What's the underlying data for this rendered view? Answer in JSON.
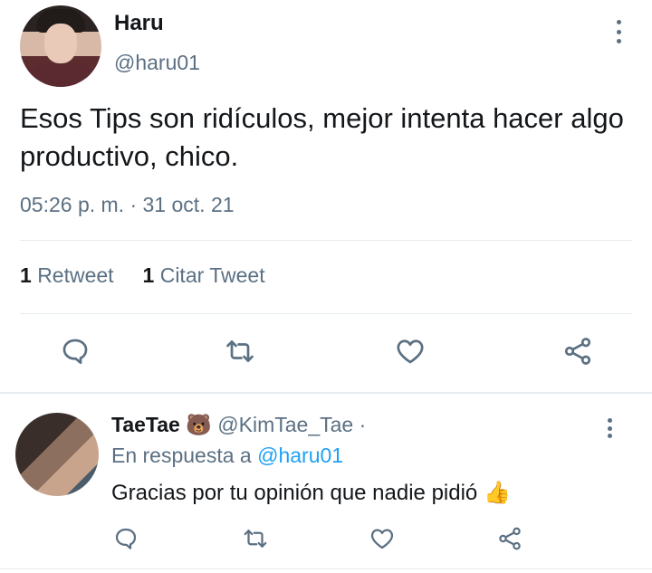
{
  "tweet": {
    "author_name": "Haru",
    "author_handle": "@haru01",
    "text": "Esos Tips son ridículos, mejor intenta hacer algo productivo, chico.",
    "timestamp": "05:26 p. m. · 31 oct. 21",
    "retweet_count": "1",
    "retweet_label": "Retweet",
    "quote_count": "1",
    "quote_label": "Citar Tweet",
    "actions": [
      "reply-icon",
      "retweet-icon",
      "like-icon",
      "share-icon"
    ]
  },
  "reply": {
    "author_name": "TaeTae",
    "author_emoji": "🐻",
    "author_handle": "@KimTae_Tae",
    "separator": " · ",
    "in_reply_prefix": "En respuesta a",
    "in_reply_mention": "@haru01",
    "text": "Gracias por tu opinión que nadie pidió",
    "text_emoji": "👍",
    "actions": [
      "reply-icon",
      "retweet-icon",
      "like-icon",
      "share-icon"
    ]
  },
  "colors": {
    "text": "#14171a",
    "secondary": "#5b7083",
    "link": "#1da1f2",
    "divider": "#e6ecf0"
  }
}
